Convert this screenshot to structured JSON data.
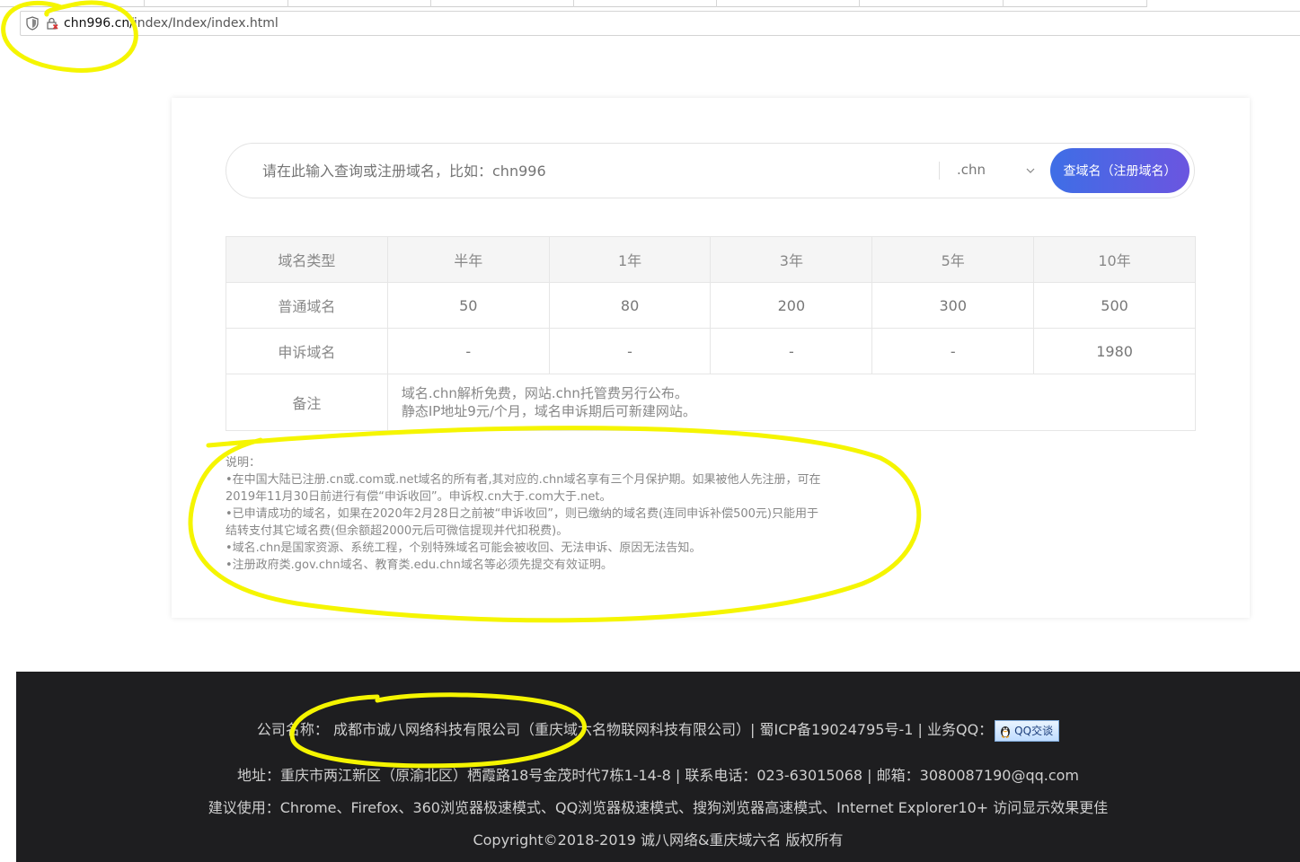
{
  "browser": {
    "url_host": "chn996.cn/",
    "url_path": "index/Index/index.html"
  },
  "search": {
    "placeholder": "请在此输入查询或注册域名，比如：chn996",
    "tld_selected": ".chn",
    "button_label": "查域名（注册域名）"
  },
  "price_table": {
    "headers": [
      "域名类型",
      "半年",
      "1年",
      "3年",
      "5年",
      "10年"
    ],
    "rows": [
      [
        "普通域名",
        "50",
        "80",
        "200",
        "300",
        "500"
      ],
      [
        "申诉域名",
        "-",
        "-",
        "-",
        "-",
        "1980"
      ]
    ],
    "note_label": "备注",
    "note_lines": [
      "域名.chn解析免费，网站.chn托管费另行公布。",
      "静态IP地址9元/个月，域名申诉期后可新建网站。"
    ]
  },
  "explanation": {
    "title": "说明：",
    "lines": [
      "•在中国大陆已注册.cn或.com或.net域名的所有者,其对应的.chn域名享有三个月保护期。如果被他人先注册，可在",
      "2019年11月30日前进行有偿“申诉收回”。申诉权.cn大于.com大于.net。",
      "•已申请成功的域名，如果在2020年2月28日之前被“申诉收回”，则已缴纳的域名费(连同申诉补偿500元)只能用于",
      "结转支付其它域名费(但余额超2000元后可微信提现并代扣税费)。",
      "•域名.chn是国家资源、系统工程，个别特殊域名可能会被收回、无法申诉、原因无法告知。",
      "•注册政府类.gov.chn域名、教育类.edu.chn域名等必须先提交有效证明。"
    ]
  },
  "footer": {
    "line1": "公司名称： 成都市诚八网络科技有限公司（重庆域六名物联网科技有限公司）| 蜀ICP备19024795号-1 | 业务QQ：",
    "qq_button": "QQ交谈",
    "line2": "地址：重庆市两江新区（原渝北区）栖霞路18号金茂时代7栋1-14-8 | 联系电话：023-63015068 | 邮箱：3080087190@qq.com",
    "line3": "建议使用：Chrome、Firefox、360浏览器极速模式、QQ浏览器极速模式、搜狗浏览器高速模式、Internet Explorer10+ 访问显示效果更佳",
    "line4": "Copyright©2018-2019 诚八网络&重庆域六名 版权所有"
  },
  "colors": {
    "accent_start": "#3e6ee6",
    "accent_end": "#6b55e0",
    "footer_bg": "#1e1e20",
    "annotation": "#f5f500"
  },
  "icons": [
    "shield-icon",
    "insecure-lock-icon",
    "chevron-down-icon",
    "qq-penguin-icon"
  ]
}
